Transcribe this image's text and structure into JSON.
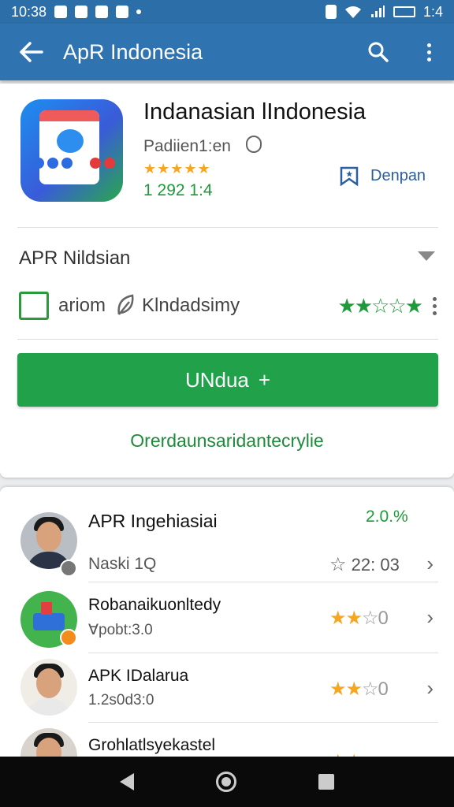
{
  "status_bar": {
    "time": "10:38",
    "clock_right": "1:4"
  },
  "app_bar": {
    "title": "ApR Indonesia",
    "back_icon": "arrow-left-icon",
    "search_icon": "search-icon",
    "more_icon": "more-vertical-icon"
  },
  "app": {
    "name": "Indanasian lIndonesia",
    "publisher": "Padiien1:en",
    "rating_stars": 5,
    "downloads": "1 292 1:4",
    "wishlist_label": "Denpan"
  },
  "details": {
    "section_title": "APR Nildsian",
    "item1_label": "ariom",
    "item2_label": "Klndadsimy",
    "rating_stars": "★★☆☆★"
  },
  "actions": {
    "install_label": "UNdua",
    "install_icon": "+",
    "more_link": "Orerdaunsaridantecrylie"
  },
  "list": {
    "items": [
      {
        "name": "APR Ingehiasiai",
        "sub": "Naski 1Q",
        "rating": "22: 03",
        "pct": "2.0.%"
      },
      {
        "name": "Robanaikuonltedy",
        "sub": "Ɐpobt:3.0",
        "stars": "★★",
        "empty": "☆0"
      },
      {
        "name": "APK IDalarua",
        "sub": "1.2s0d3:0",
        "stars": "★★",
        "empty": "☆0"
      },
      {
        "name": "Grohlatlsyekastel"
      }
    ]
  },
  "colors": {
    "appbar": "#2f74b1",
    "accent_green": "#21a24a",
    "star": "#f5a623"
  }
}
